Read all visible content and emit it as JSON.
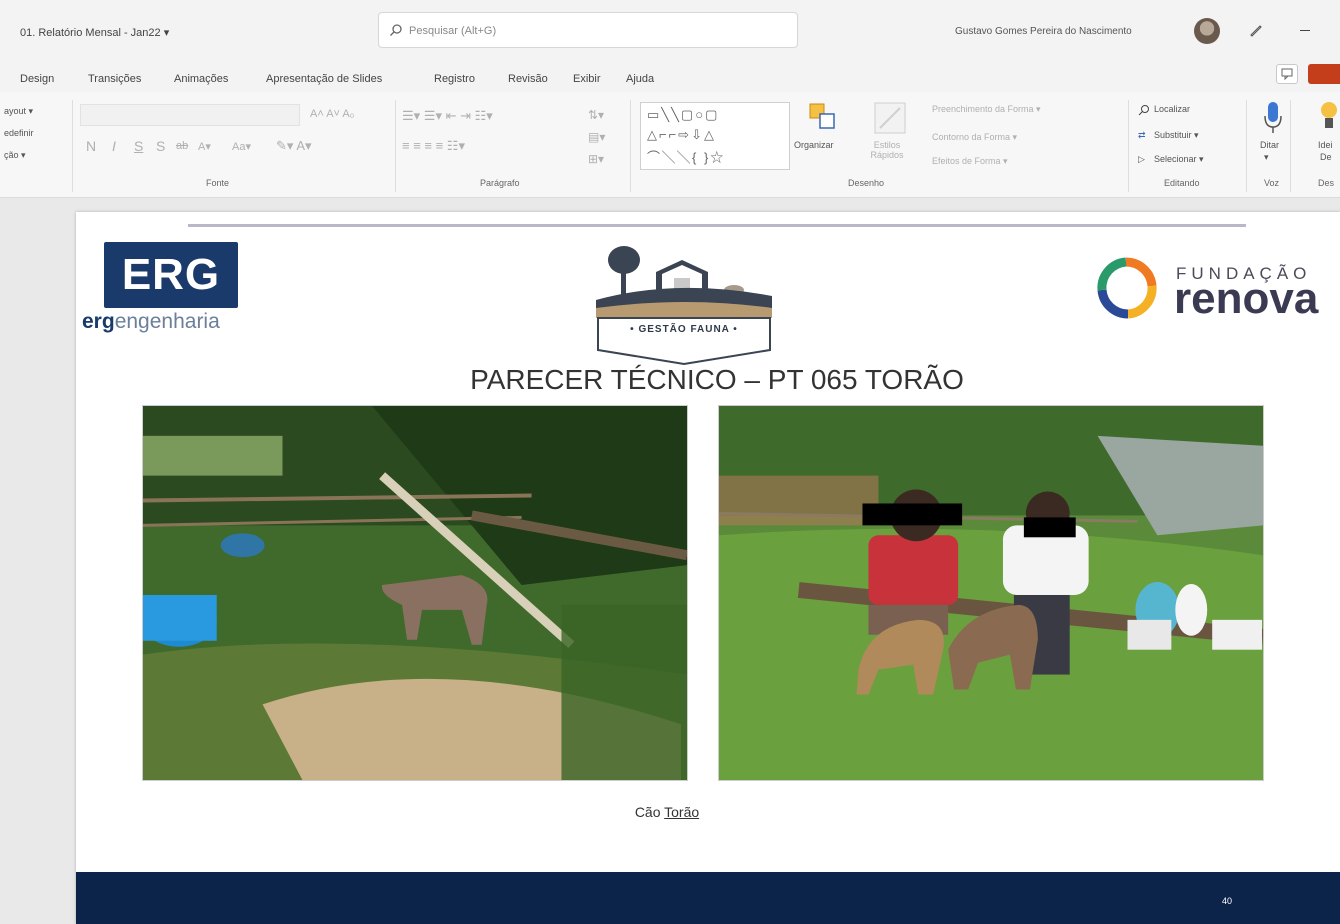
{
  "app": {
    "doc_title": "01. Relatório Mensal - Jan22 ▾",
    "search_placeholder": "Pesquisar (Alt+G)",
    "user_name": "Gustavo Gomes Pereira do Nascimento"
  },
  "menu": [
    "Design",
    "Transições",
    "Animações",
    "Apresentação de Slides",
    "Registro",
    "Revisão",
    "Exibir",
    "Ajuda"
  ],
  "ribbon": {
    "layout_items": [
      "ayout ▾",
      "edefinir",
      "ção ▾"
    ],
    "font_format": [
      "N",
      "I",
      "S",
      "S",
      "ab",
      "A▾",
      "Aa▾"
    ],
    "font_group": "Fonte",
    "paragraph_group": "Parágrafo",
    "organize_label": "Organizar",
    "quick_styles_label": "Estilos Rápidos",
    "shape_fill": "Preenchimento da Forma ▾",
    "shape_outline": "Contorno da Forma ▾",
    "shape_effects": "Efeitos de Forma ▾",
    "drawing_group": "Desenho",
    "find_label": "Localizar",
    "replace_label": "Substituir ▾",
    "select_label": "Selecionar ▾",
    "editing_group": "Editando",
    "dictate_label": "Ditar",
    "voice_group": "Voz",
    "ideas_label_1": "Idei",
    "ideas_label_2": "De",
    "designer_group": "Des"
  },
  "slide": {
    "erg_logo": "ERG",
    "erg_sub_bold": "erg",
    "erg_sub_rest": "engenharia",
    "gf_label": "• GESTÃO FAUNA •",
    "renova_top": "FUNDAÇÃO",
    "renova_word": "renova",
    "title": "PARECER TÉCNICO – PT 065 TORÃO",
    "caption_prefix": "Cão ",
    "caption_name": "Torão",
    "page_number": "40"
  },
  "colors": {
    "erg_blue": "#1a3a6c",
    "footer_navy": "#0c2449",
    "share_red": "#c43e1c"
  }
}
